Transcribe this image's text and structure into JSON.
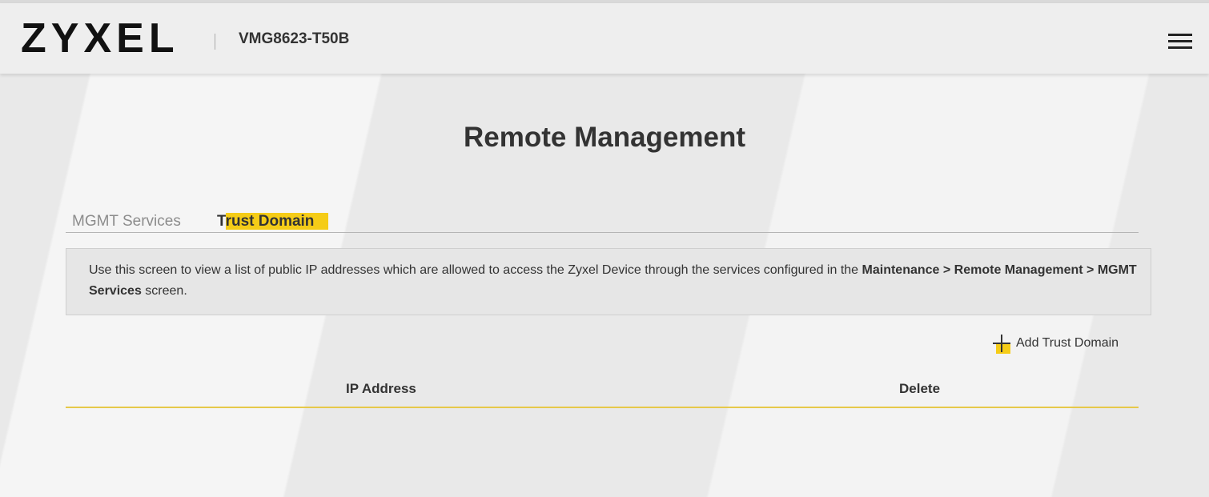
{
  "header": {
    "logo_text": "ZYXEL",
    "model": "VMG8623-T50B",
    "menu_icon": "hamburger-menu-icon"
  },
  "page": {
    "title": "Remote Management"
  },
  "tabs": [
    {
      "label": "MGMT Services",
      "active": false
    },
    {
      "label_head": "T",
      "label_rest": "rust Domain",
      "label": "Trust Domain",
      "active": true
    }
  ],
  "info": {
    "text_before": "Use this screen to view a list of public IP addresses which are allowed to access the Zyxel Device through the services configured in the ",
    "bold_path": "Maintenance > Remote Management > MGMT Services",
    "text_after": " screen."
  },
  "actions": {
    "add_label": "Add Trust Domain",
    "add_icon": "plus-icon"
  },
  "table": {
    "columns": [
      "IP Address",
      "Delete"
    ],
    "rows": []
  },
  "colors": {
    "accent": "#f5cc17",
    "table_rule": "#e6c94a",
    "text": "#333333",
    "inactive_tab": "#8c8c8c"
  }
}
